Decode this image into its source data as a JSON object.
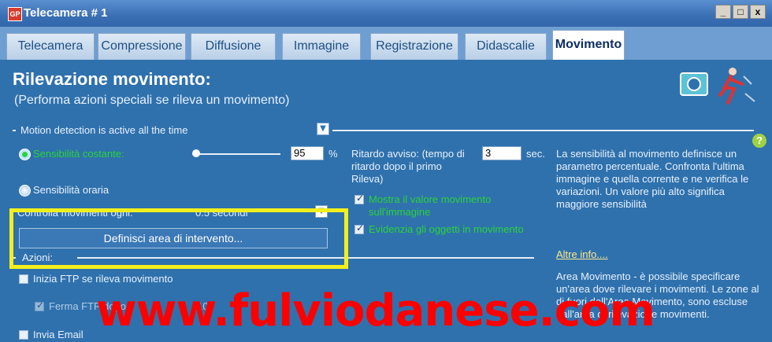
{
  "window": {
    "title": "Telecamera # 1",
    "icon_text": "GP",
    "buttons": [
      "_",
      "□",
      "x"
    ]
  },
  "tabs": [
    "Telecamera",
    "Compressione",
    "Diffusione",
    "Immagine",
    "Registrazione",
    "Didascalie",
    "Movimento"
  ],
  "section": {
    "title": "Rilevazione movimento:",
    "subtitle": "(Performa azioni speciali se rileva un movimento)"
  },
  "motion": {
    "mode": "Motion detection is active all the time",
    "sens_constant": "Sensibilità costante:",
    "sens_value": "95",
    "sens_percent": "%",
    "sens_hourly": "Sensibilità oraria",
    "control_label": "Controlla movimenti ogni:",
    "control_value": "0.5 secondi",
    "define_button": "Definisci area di intervento...",
    "actions_label": "Azioni:"
  },
  "alarm": {
    "delay_label": "Ritardo avviso: (tempo di",
    "delay_label2": "ritardo dopo il primo",
    "delay_label3": "Rileva)",
    "delay_value": "3",
    "delay_unit": "sec.",
    "show_value": "Mostra il valore movimento",
    "show_value2": "sull'immagine",
    "highlight_objects": "Evidenzia gli oggetti in movimento"
  },
  "help_text": {
    "line1": "La sensibilità al movimento definisce un",
    "line2": "parametro percentuale. Confronta l'ultima",
    "line3": "immagine e quella corrente e ne verifica le",
    "line4": "variazioni. Un valore più alto significa",
    "line5": "maggiore sensibilità",
    "more_info": "Altre info....",
    "area1": "Area Movimento - è possibile specificare",
    "area2": "un'area dove rilevare i movimenti. Le zone al",
    "area3": "di fuori dell'Area Movimento, sono escluse",
    "area4": "dall'area di rilevazione movimenti."
  },
  "actions": {
    "ftp": "Inizia FTP se rileva movimento",
    "ftp_stop": "Ferma FTP dopo",
    "ftp_stop_value": "10",
    "email": "Invia Email"
  },
  "watermark": "www.fulviodanese.com"
}
